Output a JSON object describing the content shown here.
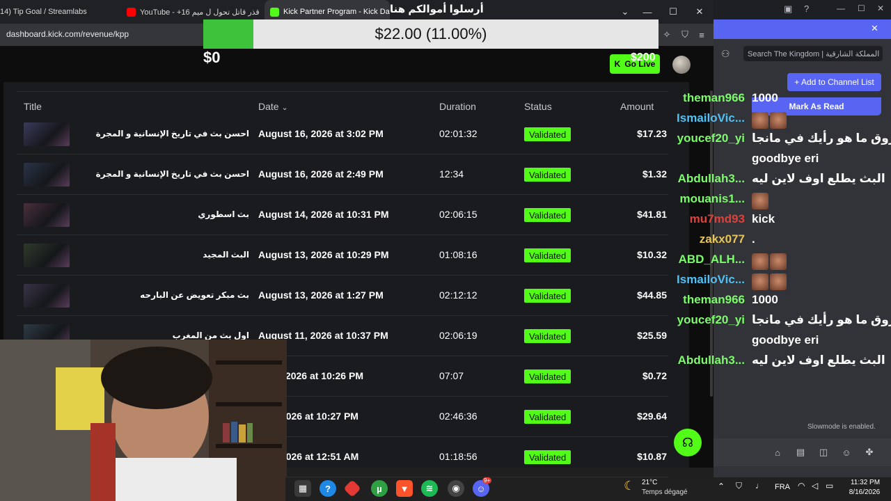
{
  "browser": {
    "tabs": [
      {
        "label": "14) Tip Goal / Streamlabs"
      },
      {
        "label": "(15) اقذر قاتل تحول ل ميم 16+ - YouTube"
      },
      {
        "label": "Kick Partner Program - Kick Dash"
      }
    ],
    "url": "dashboard.kick.com/revenue/kpp",
    "window_controls": {
      "min": "—",
      "max": "☐",
      "close": "✕"
    }
  },
  "overlay": {
    "title": "أرسلوا أموالكم هنا",
    "goal_text": "$22.00 (11.00%)",
    "goal_progress": 0.11,
    "goal_start": "$0",
    "goal_max": "$200"
  },
  "dashboard": {
    "go_live": "Go Live",
    "columns": {
      "title": "Title",
      "date": "Date",
      "duration": "Duration",
      "status": "Status",
      "amount": "Amount"
    },
    "rows": [
      {
        "title": "احسن بث في تاريخ الإنسانية و المجرة",
        "date": "August 16, 2026 at 3:02 PM",
        "duration": "02:01:32",
        "status": "Validated",
        "amount": "$17.23"
      },
      {
        "title": "احسن بث في تاريخ الإنسانية و المجرة",
        "date": "August 16, 2026 at 2:49 PM",
        "duration": "12:34",
        "status": "Validated",
        "amount": "$1.32"
      },
      {
        "title": "بث اسطوري",
        "date": "August 14, 2026 at 10:31 PM",
        "duration": "02:06:15",
        "status": "Validated",
        "amount": "$41.81"
      },
      {
        "title": "البث المجيد",
        "date": "August 13, 2026 at 10:29 PM",
        "duration": "01:08:16",
        "status": "Validated",
        "amount": "$10.32"
      },
      {
        "title": "بث مبكر تعويض عن البارحه",
        "date": "August 13, 2026 at 1:27 PM",
        "duration": "02:12:12",
        "status": "Validated",
        "amount": "$44.85"
      },
      {
        "title": "اول بث من المغرب",
        "date": "August 11, 2026 at 10:37 PM",
        "duration": "02:06:19",
        "status": "Validated",
        "amount": "$25.59"
      },
      {
        "title": "",
        "date": "st 11, 2026 at 10:26 PM",
        "duration": "07:07",
        "status": "Validated",
        "amount": "$0.72"
      },
      {
        "title": "",
        "date": "st 8, 2026 at 10:27 PM",
        "duration": "02:46:36",
        "status": "Validated",
        "amount": "$29.64"
      },
      {
        "title": "",
        "date": "st 8, 2026 at 12:51 AM",
        "duration": "01:18:56",
        "status": "Validated",
        "amount": "$10.87"
      }
    ]
  },
  "chat": [
    {
      "user": "theman966",
      "color": "#7cfc6a",
      "msg": "1000"
    },
    {
      "user": "IsmailoVic...",
      "color": "#4fc3f7",
      "msg": ""
    },
    {
      "user": "youcef20_yi",
      "color": "#7cfc6a",
      "msg": "فاروق ما هو رأيك في مانجا"
    },
    {
      "user": "",
      "color": "#7cfc6a",
      "msg": "goodbye eri"
    },
    {
      "user": "Abdullah3...",
      "color": "#7cfc6a",
      "msg": "البث يطلع اوف لاين ليه"
    },
    {
      "user": "mouanis1...",
      "color": "#7cfc6a",
      "msg": ""
    },
    {
      "user": "mu7md93",
      "color": "#e0413a",
      "msg": "kick"
    },
    {
      "user": "zakx077",
      "color": "#e6c65a",
      "msg": "."
    },
    {
      "user": "ABD_ALH...",
      "color": "#7cfc6a",
      "msg": ""
    },
    {
      "user": "IsmailoVic...",
      "color": "#4fc3f7",
      "msg": ""
    },
    {
      "user": "theman966",
      "color": "#7cfc6a",
      "msg": "1000"
    },
    {
      "user": "youcef20_yi",
      "color": "#7cfc6a",
      "msg": "فاروق ما هو رأيك في مانجا"
    },
    {
      "user": "",
      "color": "#7cfc6a",
      "msg": "goodbye eri"
    },
    {
      "user": "Abdullah3...",
      "color": "#7cfc6a",
      "msg": "البث يطلع اوف لاين ليه"
    }
  ],
  "right_panel": {
    "search_placeholder": "Search The Kingdom | المملكة الشارقية",
    "add_channel": "+ Add to Channel List",
    "mark_read": "Mark As Read",
    "slowmode": "Slowmode is enabled."
  },
  "taskbar": {
    "temperature": "21°C",
    "weather": "Temps dégagé",
    "lang": "FRA",
    "time": "11:32 PM",
    "date": "8/16/2026",
    "discord_badge": "9+"
  }
}
